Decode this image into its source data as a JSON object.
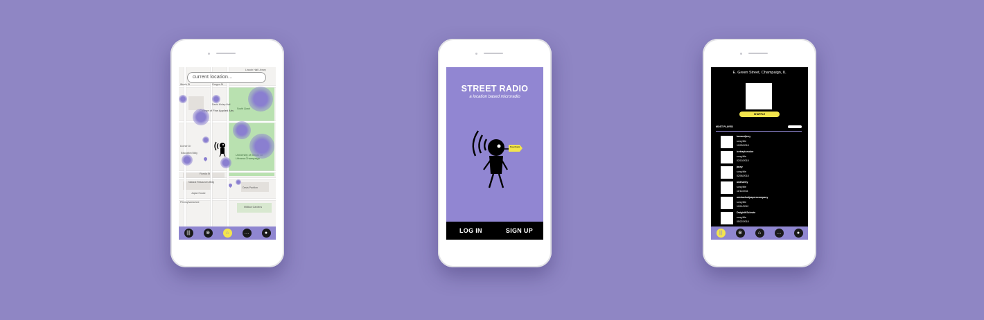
{
  "map_screen": {
    "search_value": "current location...",
    "map_labels": [
      "Lincoln Hall Library",
      "Illinois St",
      "Oregon St",
      "College of Fine Applied Arts",
      "David Kinley Hall",
      "South Quad",
      "Education Bldg",
      "University of Illinois at Urbana-Champaign",
      "Natural Resources Bldg",
      "Davis Pavilion",
      "Japan House",
      "Millikan Gardens",
      "Florida St",
      "Pennsylvania Ave",
      "Dorner Dr"
    ],
    "nav_icons": [
      "library-icon",
      "radio-tower-icon",
      "home-icon",
      "chat-icon",
      "profile-icon"
    ],
    "active_nav_index": 2
  },
  "splash_screen": {
    "title": "STREET RADIO",
    "subtitle": "a location based microradio",
    "flag_text": "Street Radio",
    "login_label": "LOG IN",
    "signup_label": "SIGN UP"
  },
  "station_screen": {
    "location": "E. Green Street, Champaign, IL",
    "shuffle_label": "SHUFFLE",
    "most_played_label": "MOST PLAYED",
    "songs": [
      {
        "user": "tomandjerry",
        "title": "song title",
        "date": "10/25/2018"
      },
      {
        "user": "icetrayicecube",
        "title": "song title",
        "date": "02/10/2015"
      },
      {
        "user": "jassy",
        "title": "song title",
        "date": "02/06/2018"
      },
      {
        "user": "andhaeby",
        "title": "song title",
        "date": "11/11/2011"
      },
      {
        "user": "michaelsofpaperncompany",
        "title": "song title",
        "date": "10/11/2012"
      },
      {
        "user": "DwightKSchrute",
        "title": "song title",
        "date": "05/22/2018"
      }
    ],
    "nav_icons": [
      "library-icon",
      "radio-tower-icon",
      "home-icon",
      "chat-icon",
      "profile-icon"
    ],
    "active_nav_index": 0
  },
  "colors": {
    "background": "#8f86c4",
    "brand_purple": "#9186d2",
    "accent_yellow": "#f3e54d",
    "black": "#000000"
  }
}
